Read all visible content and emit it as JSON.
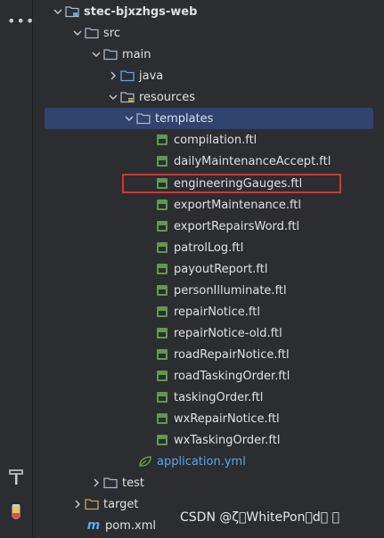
{
  "tree": {
    "root": "stec-bjxzhgs-web",
    "src": "src",
    "main": "main",
    "java": "java",
    "resources": "resources",
    "templates": "templates",
    "files": [
      "compilation.ftl",
      "dailyMaintenanceAccept.ftl",
      "engineeringGauges.ftl",
      "exportMaintenance.ftl",
      "exportRepairsWord.ftl",
      "patrolLog.ftl",
      "payoutReport.ftl",
      "personIlluminate.ftl",
      "repairNotice.ftl",
      "repairNotice-old.ftl",
      "roadRepairNotice.ftl",
      "roadTaskingOrder.ftl",
      "taskingOrder.ftl",
      "wxRepairNotice.ftl",
      "wxTaskingOrder.ftl"
    ],
    "application_yml": "application.yml",
    "test": "test",
    "target": "target",
    "pom": "pom.xml"
  },
  "watermark": "CSDN @ζ\u0000WhitePon\u0000d\u0000 \u0000",
  "colors": {
    "background": "#2b2d30",
    "selection": "#2e436e",
    "highlight_box": "#e0312e",
    "yml_text": "#56a8f5",
    "folder_icon": "#a9b7c6",
    "java_folder_icon": "#56a8f5",
    "target_folder_icon": "#c9a26d",
    "file_icon": "#5f9a4d"
  },
  "icons": {
    "more": "more-icon",
    "build": "hammer-icon",
    "test": "test-tube-icon"
  }
}
